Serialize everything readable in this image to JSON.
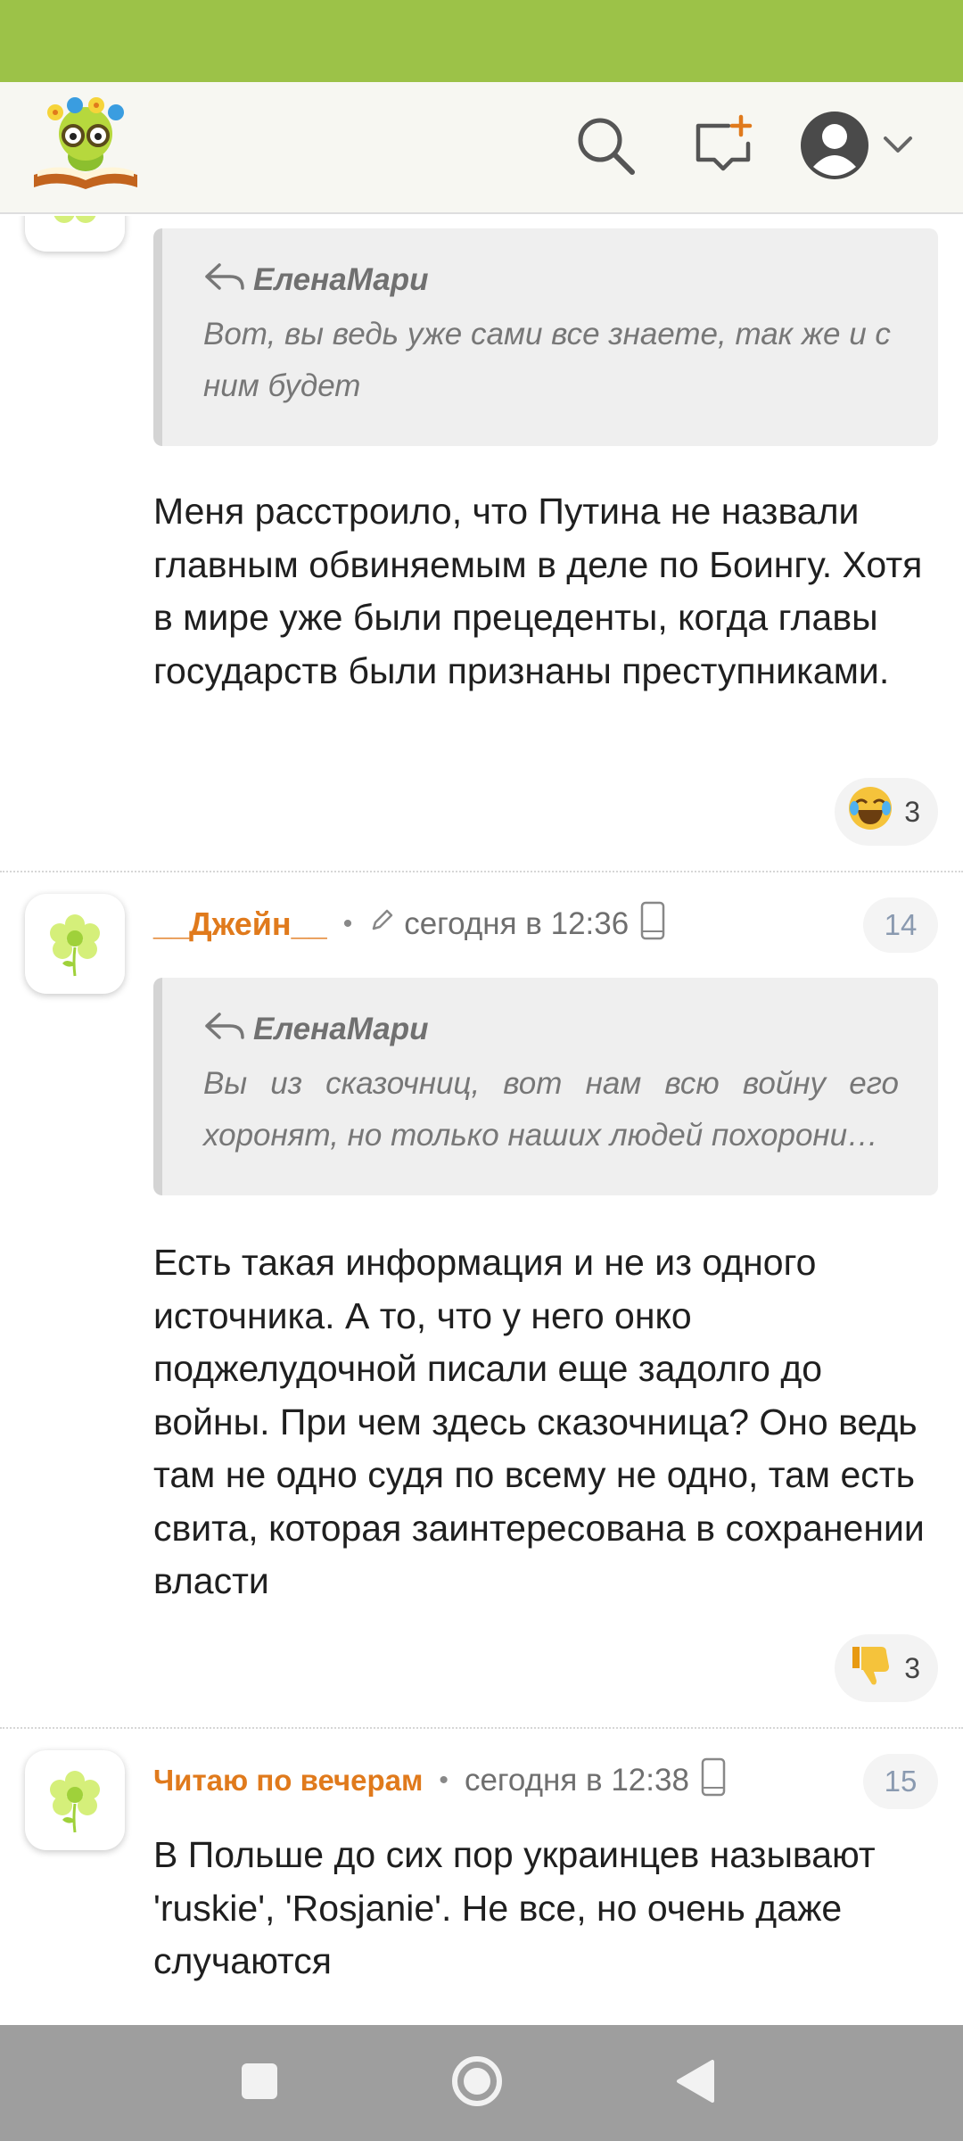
{
  "header": {
    "logo_icon": "reading-caterpillar-logo",
    "search_icon": "search-icon",
    "new_post_icon": "new-post-icon",
    "profile_icon": "profile-avatar-icon"
  },
  "colors": {
    "status_bar": "#9cc248",
    "author": "#e07a1c",
    "nav_bar": "#9e9e9e"
  },
  "comments": [
    {
      "quote_author": "ЕленаМари",
      "quote_text": "Вот, вы ведь уже сами все знаете, так же и с ним будет",
      "text": "Меня расстроило, что Путина не назвали главным обвиняемым в деле по Боингу. Хотя в мире уже были прецеденты, когда главы государств были признаны преступниками.",
      "reaction_icon": "laughing-emoji-icon",
      "reaction_count": "3"
    },
    {
      "author": "__Джейн__",
      "time": "сегодня в 12:36",
      "number": "14",
      "quote_author": "ЕленаМари",
      "quote_text": "Вы из сказочниц, вот нам всю войну его хоронят, но только наших людей похорони…",
      "text": "Есть такая информация и не из одного источника. А то, что у него онко поджелудочной писали еще задолго до войны. При чем здесь сказочница? Оно ведь там не одно судя по всему не одно, там есть свита, которая заинтересована в сохранении власти",
      "reaction_icon": "thumbs-down-icon",
      "reaction_count": "3"
    },
    {
      "author": "Читаю по вечерам",
      "time": "сегодня в 12:38",
      "number": "15",
      "text": "В Польше до сих пор украинцев называют 'ruskie', 'Rosjanie'. Не все, но очень даже случаются"
    }
  ],
  "nav": {
    "recent_icon": "recent-apps-icon",
    "home_icon": "home-icon",
    "back_icon": "back-icon"
  }
}
